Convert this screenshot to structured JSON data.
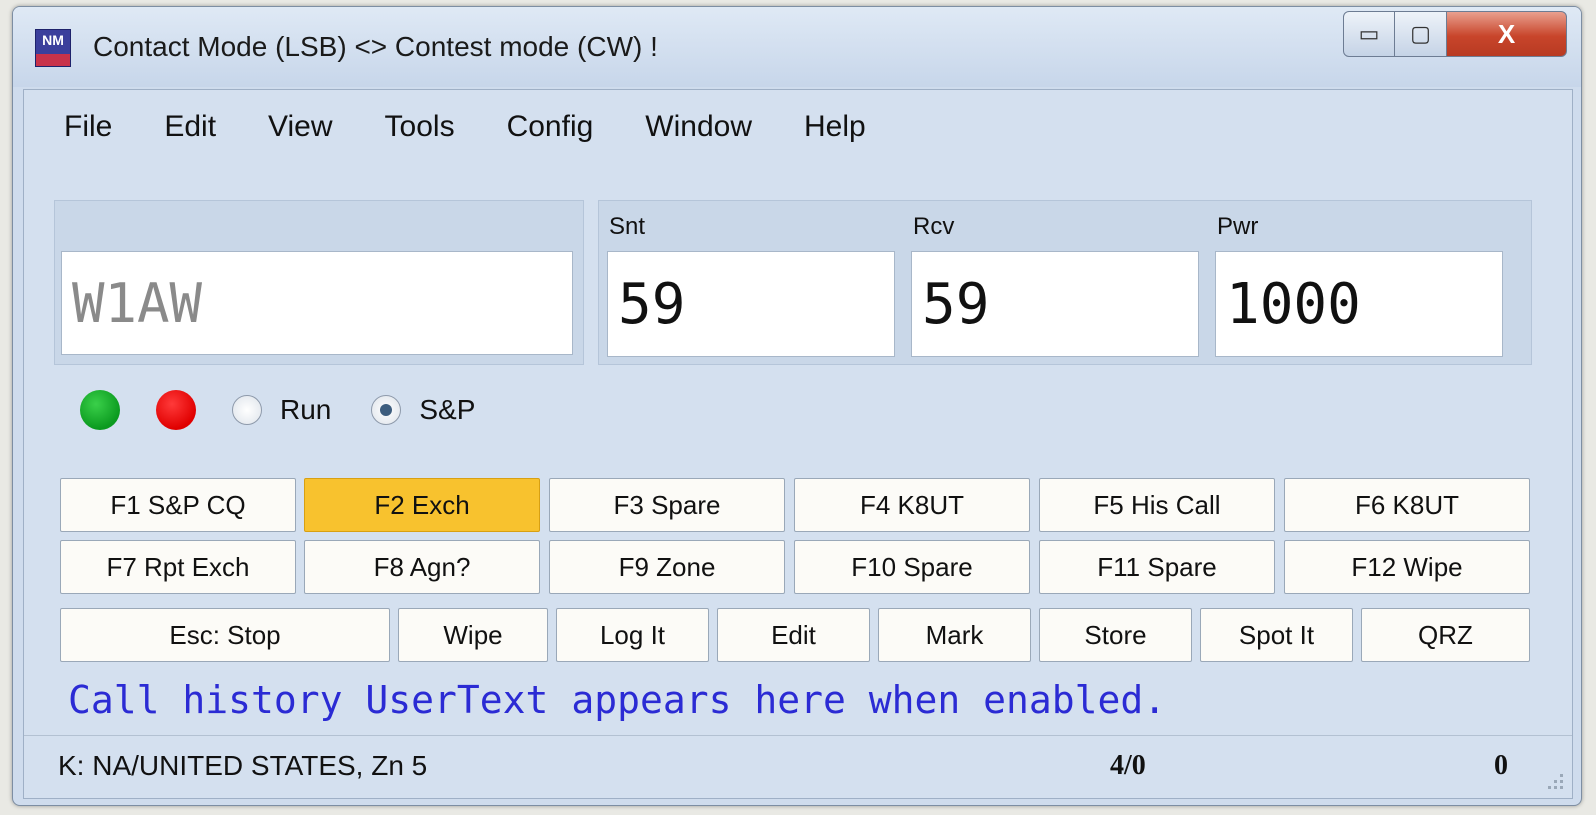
{
  "window": {
    "title": "Contact Mode (LSB) <> Contest mode (CW) !",
    "icon": "NM",
    "controls": {
      "minimize": "▭",
      "maximize": "▢",
      "close": "X"
    }
  },
  "menu": [
    "File",
    "Edit",
    "View",
    "Tools",
    "Config",
    "Window",
    "Help"
  ],
  "call_field": {
    "value": "W1AW"
  },
  "exchange": {
    "snt_label": "Snt",
    "snt_value": "59",
    "rcv_label": "Rcv",
    "rcv_value": "59",
    "pwr_label": "Pwr",
    "pwr_value": "1000"
  },
  "status": {
    "led_green": "#11a923",
    "led_red": "#ee0000",
    "run_label": "Run",
    "sp_label": "S&P",
    "selected_mode": "S&P"
  },
  "function_keys": {
    "row1": [
      "F1 S&P CQ",
      "F2 Exch",
      "F3 Spare",
      "F4 K8UT",
      "F5 His Call",
      "F6 K8UT"
    ],
    "row2": [
      "F7 Rpt Exch",
      "F8 Agn?",
      "F9 Zone",
      "F10 Spare",
      "F11 Spare",
      "F12 Wipe"
    ],
    "row3": [
      "Esc: Stop",
      "Wipe",
      "Log It",
      "Edit",
      "Mark",
      "Store",
      "Spot It",
      "QRZ"
    ],
    "active": "F2 Exch",
    "active_color": "#f8c22e"
  },
  "history_text": "Call history UserText appears here when enabled.",
  "statusbar": {
    "left": "K: NA/UNITED STATES, Zn 5",
    "middle": "4/0",
    "right": "0"
  }
}
